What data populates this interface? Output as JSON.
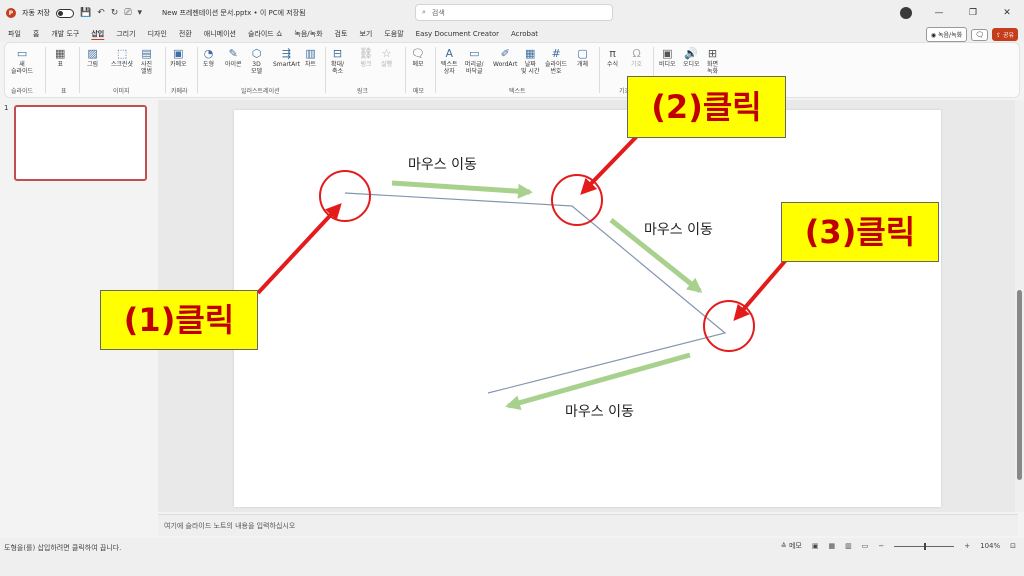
{
  "titlebar": {
    "autosave_label": "자동 저장",
    "doc_title": "New 프레젠테이션 문서.pptx • 이 PC에 저장됨",
    "search_placeholder": "검색"
  },
  "tabs": [
    "파일",
    "홈",
    "개발 도구",
    "삽입",
    "그리기",
    "디자인",
    "전환",
    "애니메이션",
    "슬라이드 쇼",
    "녹음/녹화",
    "검토",
    "보기",
    "도움말",
    "Easy Document Creator",
    "Acrobat"
  ],
  "active_tab": "삽입",
  "tab_right": {
    "record_label": "녹음/녹화",
    "share_label": "공유"
  },
  "ribbon": {
    "items": {
      "new_slide": "새\n슬라이드",
      "table": "표",
      "picture": "그림",
      "screenshot": "스크린샷",
      "photo_album": "사진\n앨범",
      "cameo": "카메오",
      "shapes": "도형",
      "icons": "아이콘",
      "models_3d": "3D\n모델",
      "smartart": "SmartArt",
      "chart": "차트",
      "zoom": "확대/\n축소",
      "link": "링크",
      "action": "실행",
      "comment": "메모",
      "textbox": "텍스트\n상자",
      "header_footer": "머리글/\n바닥글",
      "wordart": "WordArt",
      "date_time": "날짜\n및 시간",
      "slide_number": "슬라이드\n번호",
      "object": "개체",
      "equation": "수식",
      "symbol": "기호",
      "video": "비디오",
      "audio": "오디오",
      "screen_recording": "화면\n녹화"
    },
    "groups": {
      "slides": "슬라이드",
      "tables": "표",
      "images": "이미지",
      "camera": "카메라",
      "illustrations": "일러스트레이션",
      "links": "링크",
      "comments": "메모",
      "text": "텍스트",
      "symbols": "기호"
    }
  },
  "thumbnail_number": "1",
  "notes_placeholder": "여기에 슬라이드 노트의 내용을 입력하십시오",
  "status": {
    "message": "도형을(를) 삽입하려면 클릭하여 끕니다.",
    "notes_label": "메모",
    "zoom_level": "104%"
  },
  "annotations": {
    "click1": "(1)클릭",
    "click2": "(2)클릭",
    "click3": "(3)클릭",
    "move1": "마우스 이동",
    "move2": "마우스 이동",
    "move3": "마우스 이동"
  },
  "colors": {
    "accent": "#c43e1c",
    "label_bg": "#ffff00",
    "label_text": "#c00000",
    "red_arrow": "#e31b1b",
    "green_arrow": "#a9d18e",
    "poly_line": "#8497b0"
  }
}
